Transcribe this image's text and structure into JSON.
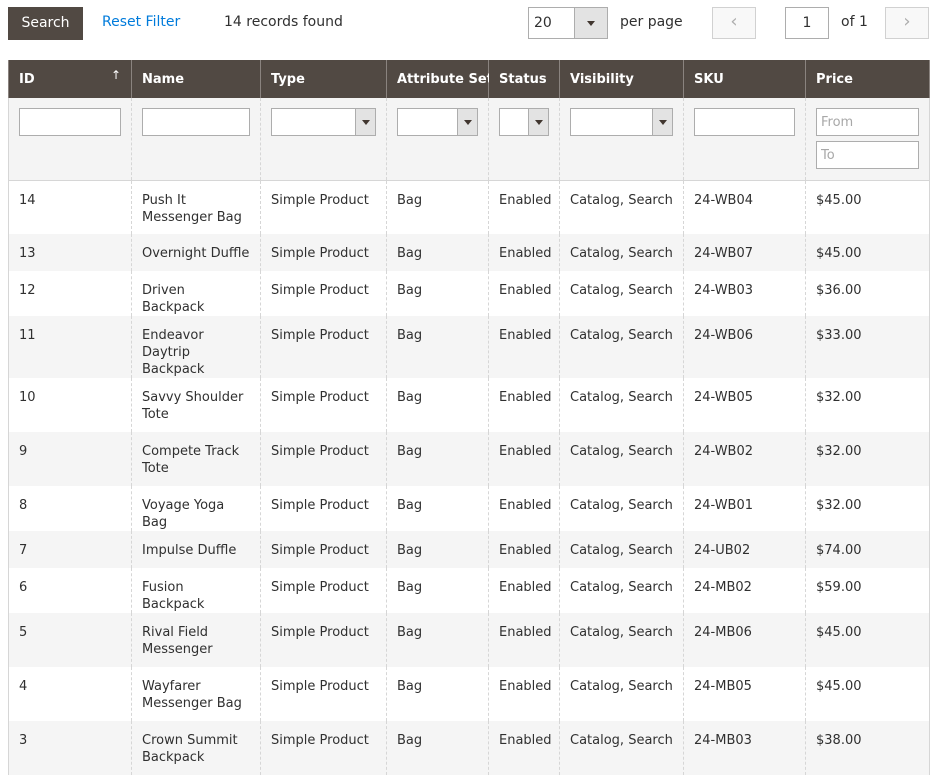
{
  "toolbar": {
    "search_label": "Search",
    "reset_filter_label": "Reset Filter",
    "records_found": "14 records found",
    "per_page_value": "20",
    "per_page_label": "per page",
    "prev_icon": "‹",
    "next_icon": "›",
    "page_value": "1",
    "page_of": "of 1"
  },
  "grid": {
    "columns": [
      {
        "key": "id",
        "label": "ID",
        "sort_icon": "↑"
      },
      {
        "key": "name",
        "label": "Name"
      },
      {
        "key": "type",
        "label": "Type"
      },
      {
        "key": "attribute_set",
        "label": "Attribute Set"
      },
      {
        "key": "status",
        "label": "Status"
      },
      {
        "key": "visibility",
        "label": "Visibility"
      },
      {
        "key": "sku",
        "label": "SKU"
      },
      {
        "key": "price",
        "label": "Price"
      }
    ],
    "filters": {
      "id": "",
      "name": "",
      "type": "",
      "attribute_set": "",
      "status": "",
      "visibility": "",
      "sku": "",
      "price_from_placeholder": "From",
      "price_to_placeholder": "To"
    },
    "rows": [
      {
        "id": "14",
        "name": "Push It Messenger Bag",
        "type": "Simple Product",
        "attribute_set": "Bag",
        "status": "Enabled",
        "visibility": "Catalog, Search",
        "sku": "24-WB04",
        "price": "$45.00"
      },
      {
        "id": "13",
        "name": "Overnight Duffle",
        "type": "Simple Product",
        "attribute_set": "Bag",
        "status": "Enabled",
        "visibility": "Catalog, Search",
        "sku": "24-WB07",
        "price": "$45.00"
      },
      {
        "id": "12",
        "name": "Driven Backpack",
        "type": "Simple Product",
        "attribute_set": "Bag",
        "status": "Enabled",
        "visibility": "Catalog, Search",
        "sku": "24-WB03",
        "price": "$36.00"
      },
      {
        "id": "11",
        "name": "Endeavor Daytrip Backpack",
        "type": "Simple Product",
        "attribute_set": "Bag",
        "status": "Enabled",
        "visibility": "Catalog, Search",
        "sku": "24-WB06",
        "price": "$33.00"
      },
      {
        "id": "10",
        "name": "Savvy Shoulder Tote",
        "type": "Simple Product",
        "attribute_set": "Bag",
        "status": "Enabled",
        "visibility": "Catalog, Search",
        "sku": "24-WB05",
        "price": "$32.00"
      },
      {
        "id": "9",
        "name": "Compete Track Tote",
        "type": "Simple Product",
        "attribute_set": "Bag",
        "status": "Enabled",
        "visibility": "Catalog, Search",
        "sku": "24-WB02",
        "price": "$32.00"
      },
      {
        "id": "8",
        "name": "Voyage Yoga Bag",
        "type": "Simple Product",
        "attribute_set": "Bag",
        "status": "Enabled",
        "visibility": "Catalog, Search",
        "sku": "24-WB01",
        "price": "$32.00"
      },
      {
        "id": "7",
        "name": "Impulse Duffle",
        "type": "Simple Product",
        "attribute_set": "Bag",
        "status": "Enabled",
        "visibility": "Catalog, Search",
        "sku": "24-UB02",
        "price": "$74.00"
      },
      {
        "id": "6",
        "name": "Fusion Backpack",
        "type": "Simple Product",
        "attribute_set": "Bag",
        "status": "Enabled",
        "visibility": "Catalog, Search",
        "sku": "24-MB02",
        "price": "$59.00"
      },
      {
        "id": "5",
        "name": "Rival Field Messenger",
        "type": "Simple Product",
        "attribute_set": "Bag",
        "status": "Enabled",
        "visibility": "Catalog, Search",
        "sku": "24-MB06",
        "price": "$45.00"
      },
      {
        "id": "4",
        "name": "Wayfarer Messenger Bag",
        "type": "Simple Product",
        "attribute_set": "Bag",
        "status": "Enabled",
        "visibility": "Catalog, Search",
        "sku": "24-MB05",
        "price": "$45.00"
      },
      {
        "id": "3",
        "name": "Crown Summit Backpack",
        "type": "Simple Product",
        "attribute_set": "Bag",
        "status": "Enabled",
        "visibility": "Catalog, Search",
        "sku": "24-MB03",
        "price": "$38.00"
      }
    ]
  }
}
